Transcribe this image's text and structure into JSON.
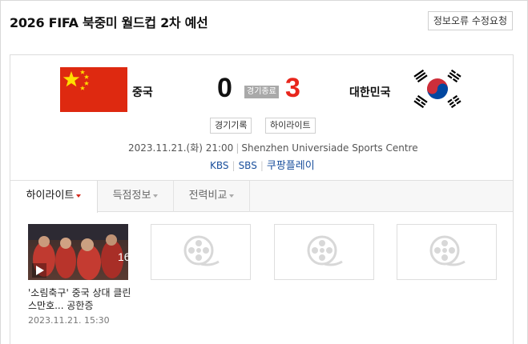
{
  "header": {
    "title": "2026 FIFA 북중미 월드컵 2차 예선",
    "report_button": "정보오류 수정요청"
  },
  "match": {
    "home_team": "중국",
    "away_team": "대한민국",
    "home_score": "0",
    "away_score": "3",
    "status": "경기종료",
    "record_button": "경기기록",
    "highlight_button": "하이라이트",
    "datetime": "2023.11.21.(화) 21:00",
    "venue": "Shenzhen Universiade Sports Centre",
    "broadcasters": [
      "KBS",
      "SBS",
      "쿠팡플레이"
    ]
  },
  "tabs": [
    {
      "label": "하이라이트",
      "active": true
    },
    {
      "label": "득점정보",
      "active": false
    },
    {
      "label": "전력비교",
      "active": false
    }
  ],
  "videos": [
    {
      "caption": "'소림축구' 중국 상대 클린스만호... 공한증",
      "date": "2023.11.21. 15:30"
    }
  ],
  "colors": {
    "away_score": "#e8261c",
    "status_badge": "#a9a9a9",
    "link": "#1a4f9c",
    "cn_flag": "#de2910"
  },
  "icons": {
    "placeholder": "film-reel-icon",
    "home_flag": "china-flag-icon",
    "away_flag": "korea-flag-icon"
  }
}
